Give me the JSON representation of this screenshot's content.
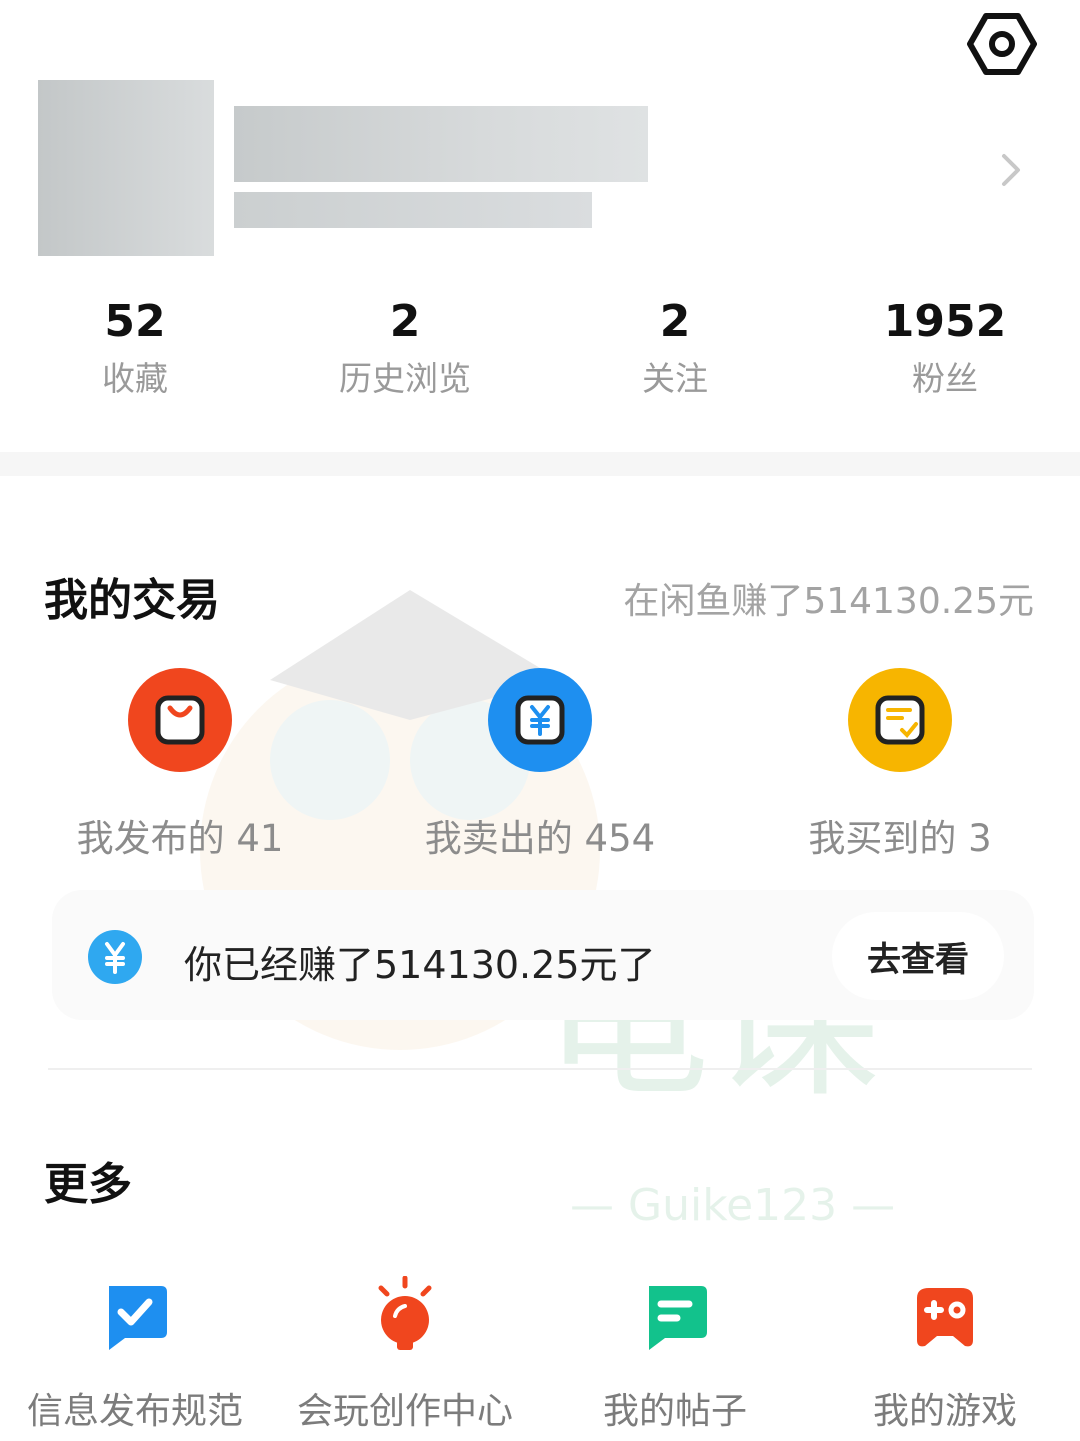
{
  "stats": [
    {
      "value": "52",
      "label": "收藏"
    },
    {
      "value": "2",
      "label": "历史浏览"
    },
    {
      "value": "2",
      "label": "关注"
    },
    {
      "value": "1952",
      "label": "粉丝"
    }
  ],
  "trades": {
    "title": "我的交易",
    "summary": "在闲鱼赚了514130.25元",
    "items": [
      {
        "label": "我发布的 41",
        "icon": "shopping-bag-icon",
        "color": "#f0461e"
      },
      {
        "label": "我卖出的 454",
        "icon": "yuan-card-icon",
        "color": "#1e8ff0"
      },
      {
        "label": "我买到的 3",
        "icon": "receipt-check-icon",
        "color": "#f7b500"
      }
    ],
    "earnings": {
      "icon": "yuan-circle-icon",
      "text": "你已经赚了514130.25元了",
      "button": "去查看"
    }
  },
  "more": {
    "title": "更多",
    "items": [
      {
        "label": "信息发布规范",
        "icon": "check-badge-icon",
        "color": "#1e8ff0"
      },
      {
        "label": "会玩创作中心",
        "icon": "lightbulb-icon",
        "color": "#f0461e"
      },
      {
        "label": "我的帖子",
        "icon": "chat-post-icon",
        "color": "#12c28c"
      },
      {
        "label": "我的游戏",
        "icon": "gamepad-icon",
        "color": "#f0461e"
      }
    ]
  },
  "watermark": {
    "text": "龟课",
    "subtext": "— Guike123 —"
  }
}
